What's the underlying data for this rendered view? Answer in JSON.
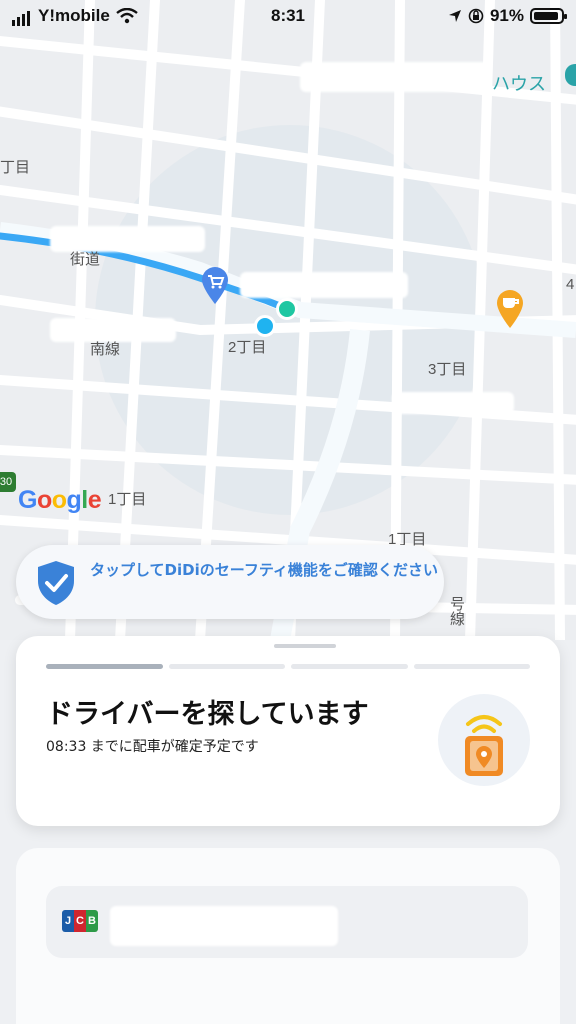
{
  "status_bar": {
    "carrier": "Y!mobile",
    "time": "8:31",
    "battery": "91%"
  },
  "map": {
    "place_label": "ハウス",
    "labels": [
      {
        "key": "chome_left",
        "text": "丁目"
      },
      {
        "key": "road_kaido",
        "text": "街道"
      },
      {
        "key": "chome_2",
        "text": "2丁目"
      },
      {
        "key": "line_south",
        "text": "南線"
      },
      {
        "key": "chome_3",
        "text": "3丁目"
      },
      {
        "key": "chome_1a",
        "text": "1丁目"
      },
      {
        "key": "chome_1b",
        "text": "1丁目"
      },
      {
        "key": "route_30",
        "text": "30"
      },
      {
        "key": "edge_4",
        "text": "4"
      },
      {
        "key": "road_gosen",
        "text": "号線"
      }
    ],
    "google_logo": "Google"
  },
  "safety_banner": {
    "text": "タップしてDiDiのセーフティ機能をご確認ください"
  },
  "status_card": {
    "title": "ドライバーを探しています",
    "subtitle": "08:33 までに配車が確定予定です",
    "progress_steps": [
      true,
      false,
      false,
      false
    ]
  },
  "payment": {
    "card_brand": "JCB"
  },
  "colors": {
    "route_blue": "#3aa8f5",
    "accent_blue": "#3a82d8",
    "pickup_green": "#1fc7a2",
    "cafe_orange": "#f5a623",
    "illus_orange": "#f08a24"
  }
}
